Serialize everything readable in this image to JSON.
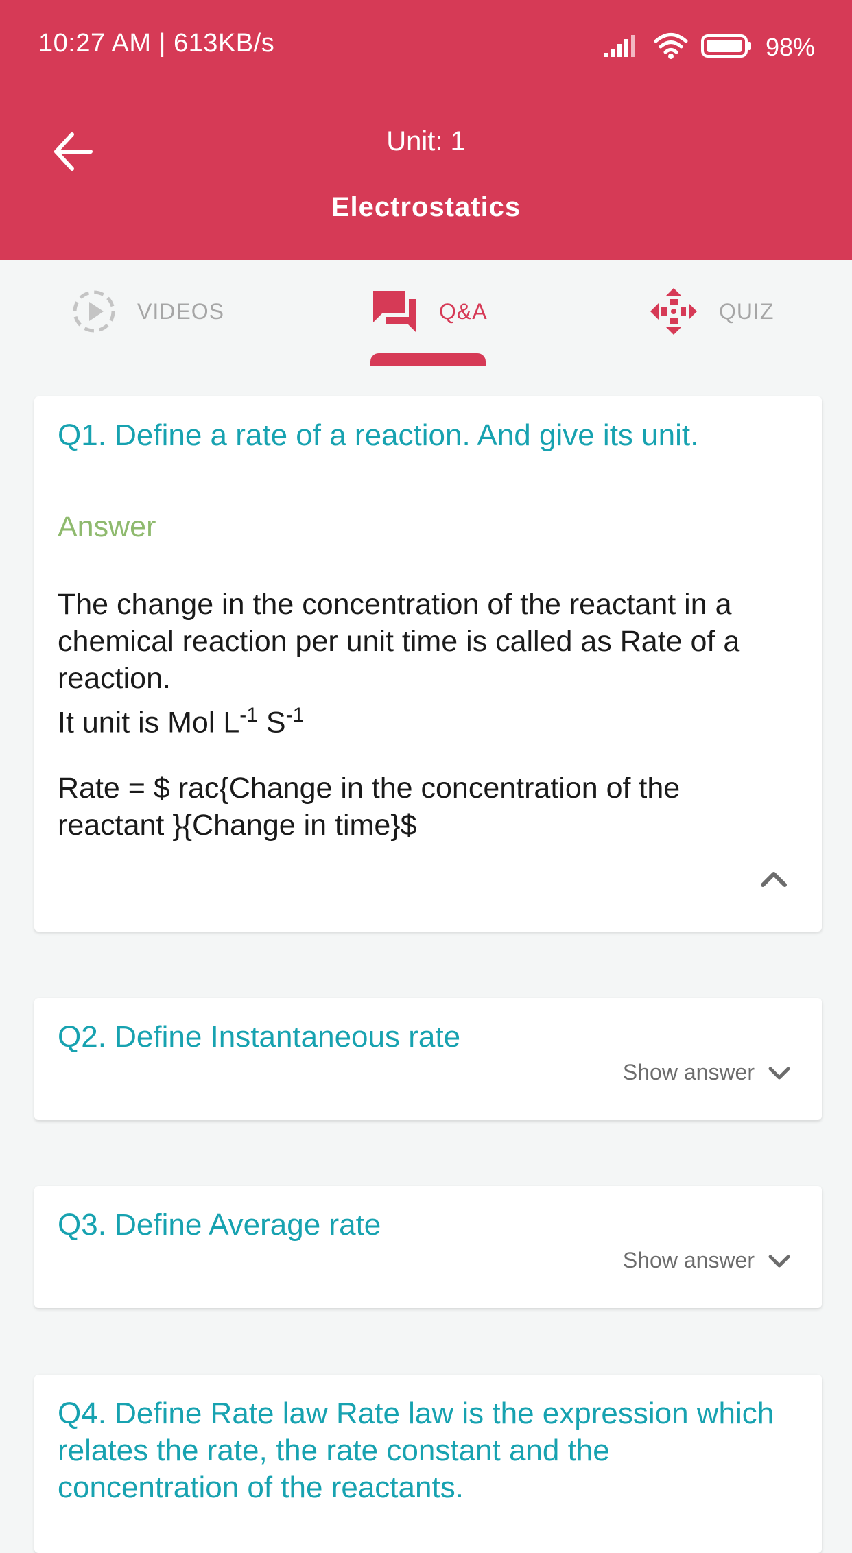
{
  "status_bar": {
    "time_speed": "10:27 AM | 613KB/s",
    "battery": "98%"
  },
  "header": {
    "unit": "Unit: 1",
    "chapter": "Electrostatics",
    "background_color": "#d63a56"
  },
  "tabs": [
    {
      "label": "VIDEOS",
      "icon": "play-circle-icon",
      "active": false
    },
    {
      "label": "Q&A",
      "icon": "chat-icon",
      "active": true
    },
    {
      "label": "QUIZ",
      "icon": "diamond-arrows-icon",
      "active": false
    }
  ],
  "questions": [
    {
      "question": "Q1. Define a rate of a reaction. And give its unit.",
      "expanded": true,
      "answer_heading": "Answer",
      "answer": {
        "line1": "The change in the concentration of the reactant in a chemical reaction per unit time is called as Rate of a reaction.",
        "unit_prefix": "It unit is Mol L",
        "unit_exp1": "-1",
        "unit_mid": " S",
        "unit_exp2": "-1",
        "formula": "Rate = $ rac{Change in the concentration of the reactant }{Change in time}$"
      }
    },
    {
      "question": "Q2. Define Instantaneous rate",
      "expanded": false,
      "toggle_label": "Show answer"
    },
    {
      "question": "Q3. Define Average rate",
      "expanded": false,
      "toggle_label": "Show answer"
    },
    {
      "question": "Q4. Define Rate law Rate law is the expression which relates the rate, the rate constant and the concentration of the reactants.",
      "expanded": false
    }
  ],
  "colors": {
    "accent": "#d63a56",
    "question_text": "#17a2b0",
    "answer_heading": "#8fba6e",
    "inactive_tab": "#a6a6a6"
  }
}
